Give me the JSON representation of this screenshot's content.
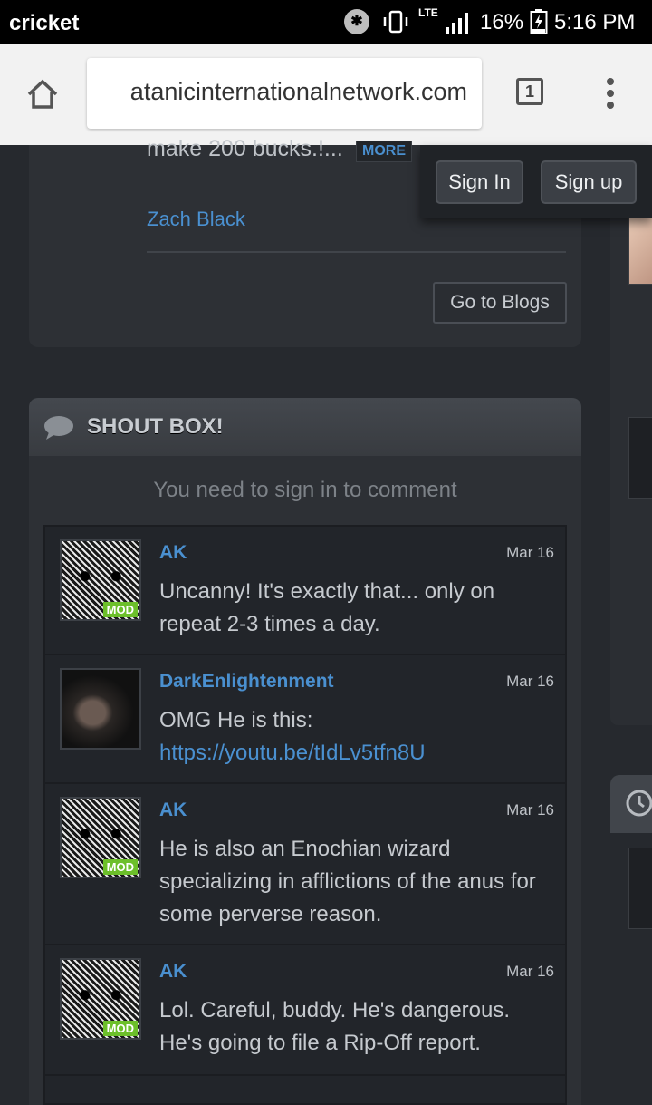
{
  "status_bar": {
    "carrier": "cricket",
    "lte": "LTE",
    "battery": "16%",
    "time": "5:16 PM"
  },
  "browser": {
    "url": "atanicinternationalnetwork.com",
    "tab_count": "1"
  },
  "blog": {
    "excerpt": "make 200 bucks.!...",
    "more_label": "MORE",
    "author": "Zach Black",
    "go_to_blogs_label": "Go to Blogs"
  },
  "auth": {
    "sign_in_label": "Sign In",
    "sign_up_label": "Sign up"
  },
  "shout_box": {
    "title": "SHOUT BOX!",
    "sign_in_note": "You need to sign in to comment",
    "mod_label": "MOD",
    "entries": [
      {
        "user": "AK",
        "date": "Mar 16",
        "text": "Uncanny! It's exactly that... only on repeat 2-3 times a day.",
        "link": ""
      },
      {
        "user": "DarkEnlightenment",
        "date": "Mar 16",
        "text": "OMG He is this:",
        "link": "https://youtu.be/tIdLv5tfn8U"
      },
      {
        "user": "AK",
        "date": "Mar 16",
        "text": "He is also an Enochian wizard specializing in afflictions of the anus for some perverse reason.",
        "link": ""
      },
      {
        "user": "AK",
        "date": "Mar 16",
        "text": "Lol. Careful, buddy. He's dangerous. He's going to file a Rip-Off report.",
        "link": ""
      }
    ]
  },
  "colors": {
    "link_blue": "#4a90d0",
    "mod_green": "#6cbf2a",
    "panel": "#2d3035",
    "background": "#26292e"
  }
}
